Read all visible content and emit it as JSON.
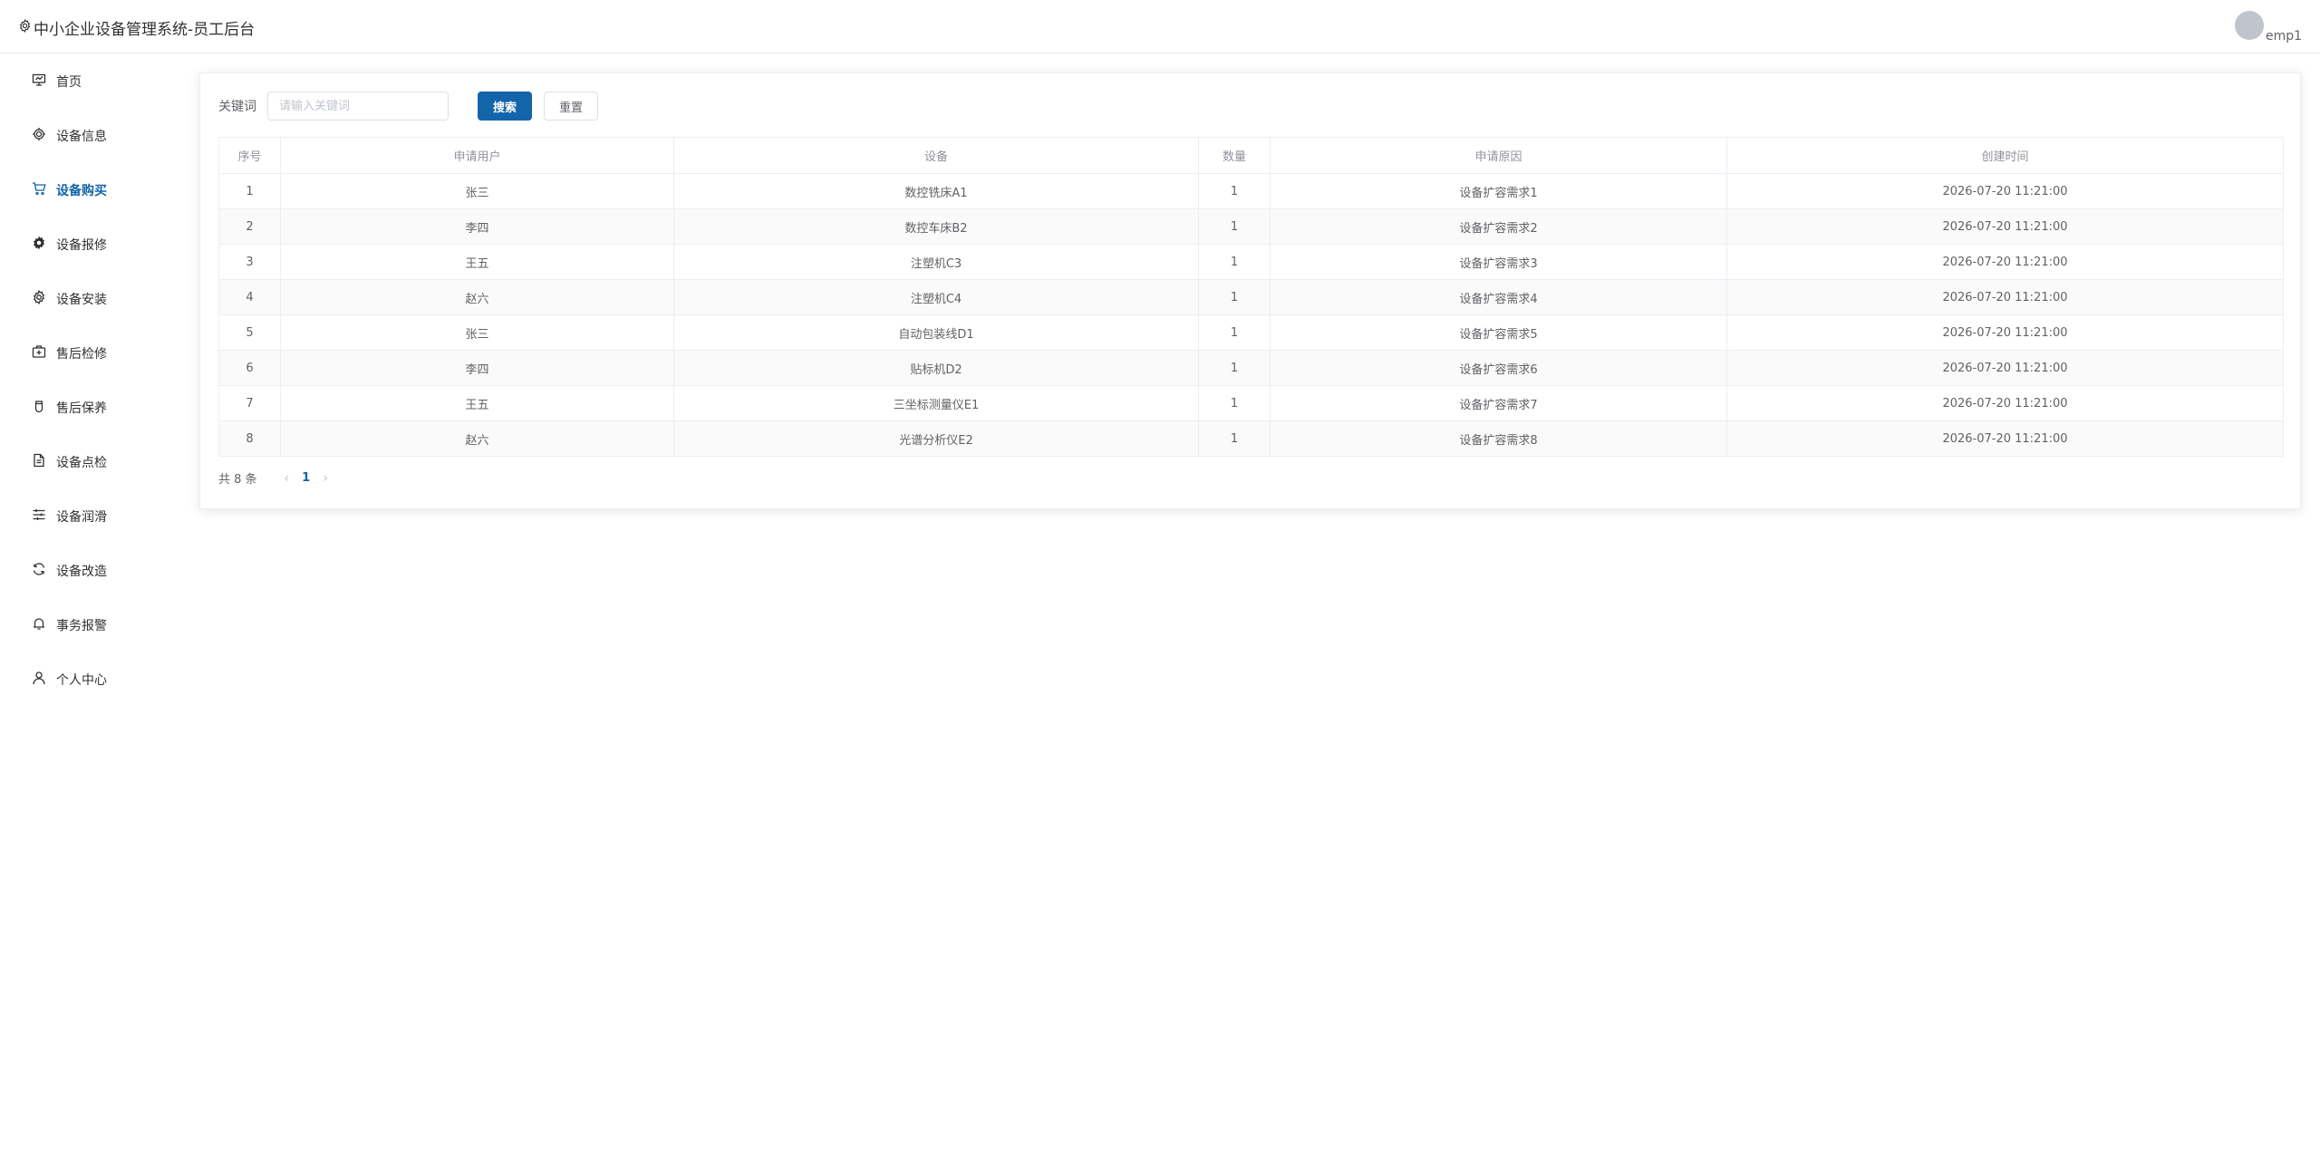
{
  "header": {
    "title": "中小企业设备管理系统-员工后台",
    "username": "emp1"
  },
  "sidebar": {
    "items": [
      {
        "label": "首页",
        "icon": "monitor-icon",
        "active": false
      },
      {
        "label": "设备信息",
        "icon": "chip-icon",
        "active": false
      },
      {
        "label": "设备购买",
        "icon": "cart-icon",
        "active": true
      },
      {
        "label": "设备报修",
        "icon": "gear-filled-icon",
        "active": false
      },
      {
        "label": "设备安装",
        "icon": "gear-icon",
        "active": false
      },
      {
        "label": "售后检修",
        "icon": "first-aid-icon",
        "active": false
      },
      {
        "label": "售后保养",
        "icon": "cup-icon",
        "active": false
      },
      {
        "label": "设备点检",
        "icon": "document-icon",
        "active": false
      },
      {
        "label": "设备润滑",
        "icon": "sliders-icon",
        "active": false
      },
      {
        "label": "设备改造",
        "icon": "refresh-icon",
        "active": false
      },
      {
        "label": "事务报警",
        "icon": "bell-icon",
        "active": false
      },
      {
        "label": "个人中心",
        "icon": "user-icon",
        "active": false
      }
    ]
  },
  "search": {
    "label": "关键词",
    "placeholder": "请输入关键词",
    "value": "",
    "search_label": "搜索",
    "reset_label": "重置"
  },
  "table": {
    "columns": [
      "序号",
      "申请用户",
      "设备",
      "数量",
      "申请原因",
      "创建时间"
    ],
    "rows": [
      [
        "1",
        "张三",
        "数控铣床A1",
        "1",
        "设备扩容需求1",
        "2026-07-20 11:21:00"
      ],
      [
        "2",
        "李四",
        "数控车床B2",
        "1",
        "设备扩容需求2",
        "2026-07-20 11:21:00"
      ],
      [
        "3",
        "王五",
        "注塑机C3",
        "1",
        "设备扩容需求3",
        "2026-07-20 11:21:00"
      ],
      [
        "4",
        "赵六",
        "注塑机C4",
        "1",
        "设备扩容需求4",
        "2026-07-20 11:21:00"
      ],
      [
        "5",
        "张三",
        "自动包装线D1",
        "1",
        "设备扩容需求5",
        "2026-07-20 11:21:00"
      ],
      [
        "6",
        "李四",
        "贴标机D2",
        "1",
        "设备扩容需求6",
        "2026-07-20 11:21:00"
      ],
      [
        "7",
        "王五",
        "三坐标测量仪E1",
        "1",
        "设备扩容需求7",
        "2026-07-20 11:21:00"
      ],
      [
        "8",
        "赵六",
        "光谱分析仪E2",
        "1",
        "设备扩容需求8",
        "2026-07-20 11:21:00"
      ]
    ]
  },
  "pagination": {
    "total_text": "共 8 条",
    "prev": "‹",
    "current_page": "1",
    "next": "›"
  },
  "colors": {
    "accent": "#1265a8",
    "stripe": "#fafafa",
    "border": "#ebeef5"
  }
}
